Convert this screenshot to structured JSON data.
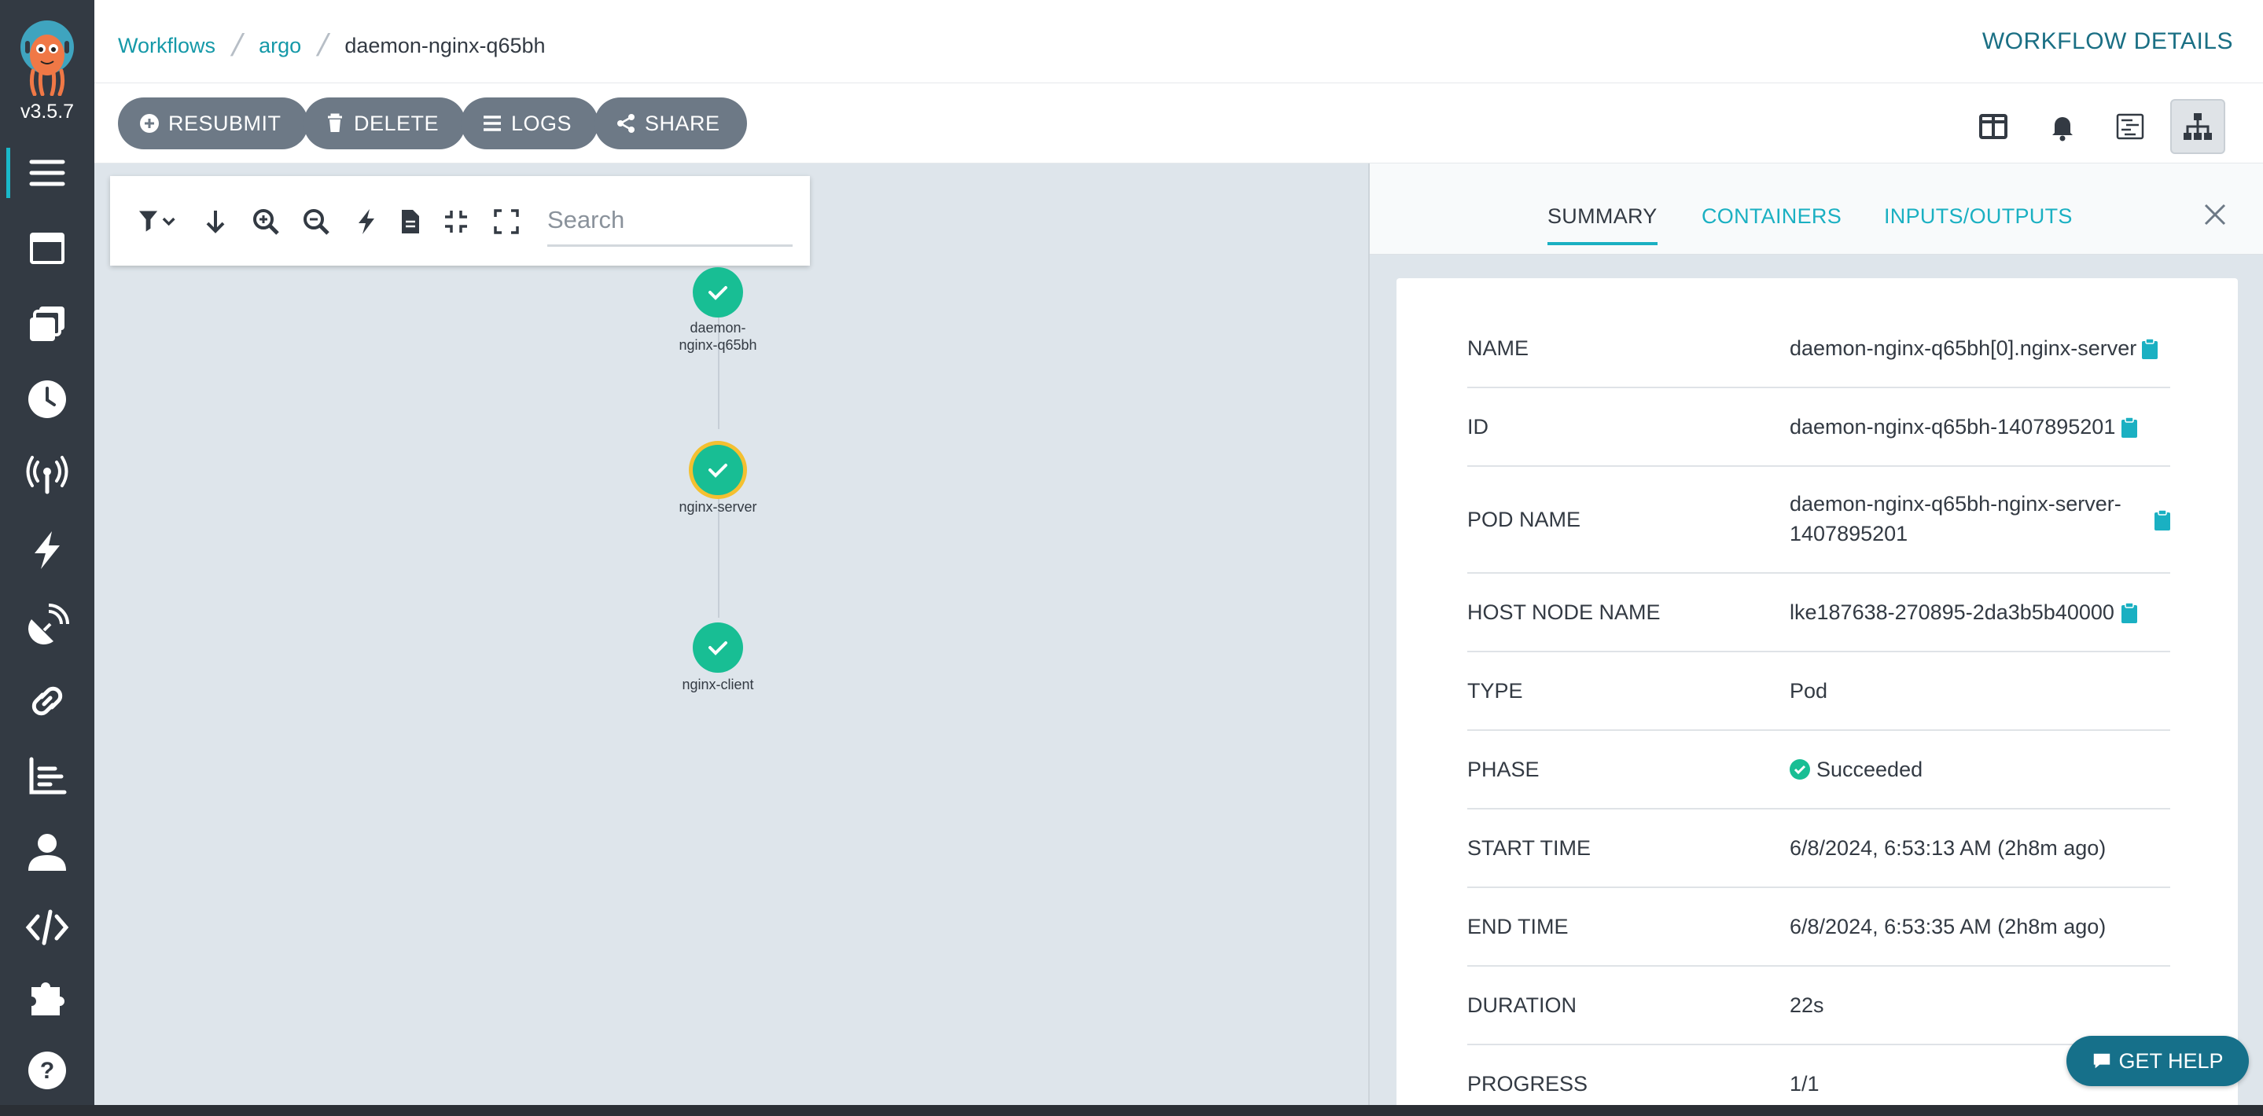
{
  "app": {
    "version": "v3.5.7",
    "page_title": "WORKFLOW DETAILS"
  },
  "breadcrumb": [
    "Workflows",
    "argo",
    "daemon-nginx-q65bh"
  ],
  "toolbar": {
    "resubmit": "RESUBMIT",
    "delete": "DELETE",
    "logs": "LOGS",
    "share": "SHARE"
  },
  "nav": {
    "items": [
      "menu-icon",
      "window-icon",
      "stack-icon",
      "clock-icon",
      "antenna-icon",
      "bolt-icon",
      "satellite-icon",
      "link-icon",
      "chart-icon",
      "user-icon",
      "code-icon",
      "puzzle-icon",
      "help-icon"
    ]
  },
  "graph": {
    "search_placeholder": "Search",
    "nodes": [
      {
        "label": "daemon-\nnginx-q65bh",
        "status": "succeeded"
      },
      {
        "label": "nginx-server",
        "status": "succeeded",
        "selected": true
      },
      {
        "label": "nginx-client",
        "status": "succeeded"
      }
    ]
  },
  "panel": {
    "tabs": [
      "SUMMARY",
      "CONTAINERS",
      "INPUTS/OUTPUTS"
    ],
    "active_tab": "SUMMARY",
    "fields": [
      {
        "key": "NAME",
        "value": "daemon-nginx-q65bh[0].nginx-server",
        "copy": true
      },
      {
        "key": "ID",
        "value": "daemon-nginx-q65bh-1407895201",
        "copy": true
      },
      {
        "key": "POD NAME",
        "value": "daemon-nginx-q65bh-nginx-server-",
        "value2": "1407895201",
        "copy": true
      },
      {
        "key": "HOST NODE NAME",
        "value": "lke187638-270895-2da3b5b40000",
        "copy": true
      },
      {
        "key": "TYPE",
        "value": "Pod"
      },
      {
        "key": "PHASE",
        "value": "Succeeded"
      },
      {
        "key": "START TIME",
        "value": "6/8/2024, 6:53:13 AM (2h8m ago)"
      },
      {
        "key": "END TIME",
        "value": "6/8/2024, 6:53:35 AM (2h8m ago)"
      },
      {
        "key": "DURATION",
        "value": "22s"
      },
      {
        "key": "PROGRESS",
        "value": "1/1"
      }
    ]
  },
  "help": {
    "label": "GET HELP"
  },
  "colors": {
    "accent": "#1ab0c2",
    "nav_bg": "#333a43",
    "success": "#18be94",
    "button": "#6d7986"
  }
}
